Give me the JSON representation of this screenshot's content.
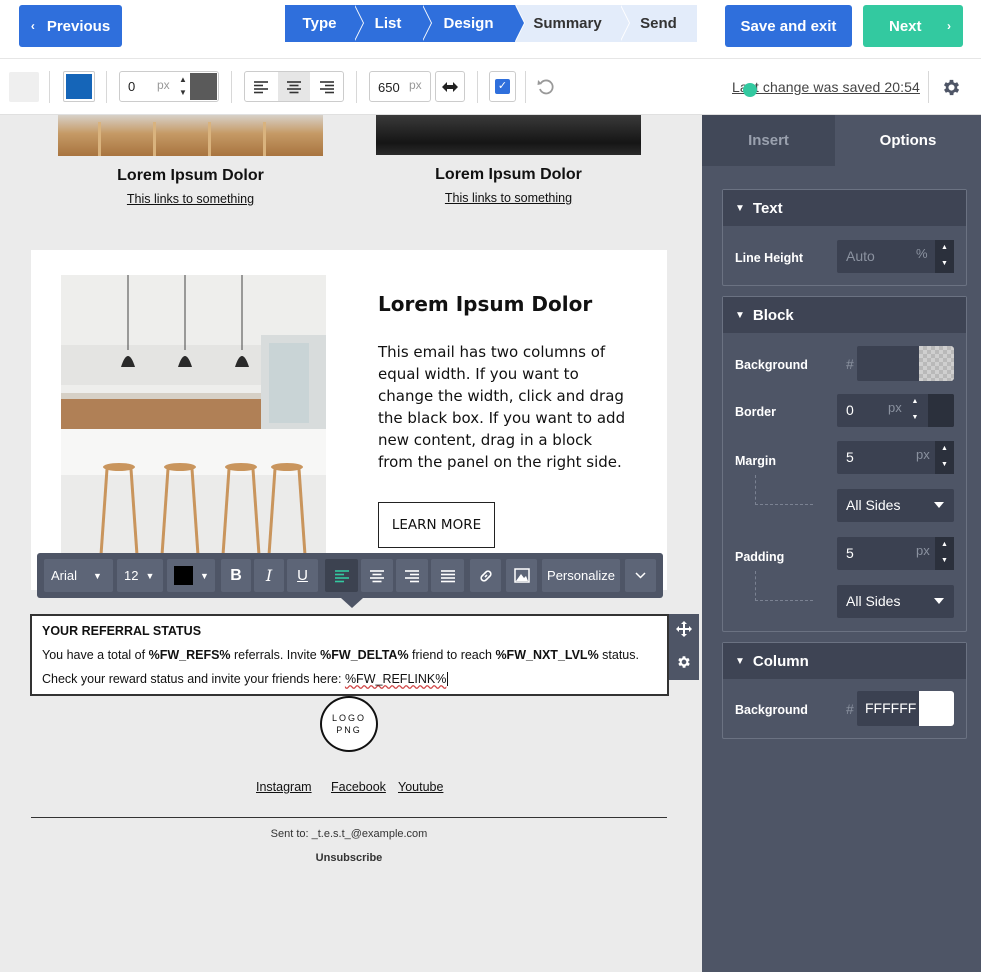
{
  "header": {
    "previous_label": "Previous",
    "save_exit_label": "Save and exit",
    "next_label": "Next",
    "steps": [
      {
        "label": "Type",
        "state": "done"
      },
      {
        "label": "List",
        "state": "done"
      },
      {
        "label": "Design",
        "state": "current"
      },
      {
        "label": "Summary",
        "state": "todo"
      },
      {
        "label": "Send",
        "state": "todo"
      }
    ]
  },
  "toolbar": {
    "border_value": "0",
    "border_unit": "px",
    "width_value": "650",
    "width_unit": "px",
    "saved_text": "Last change was saved 20:54",
    "icons": [
      "color-swatch-icon",
      "align-left-icon",
      "align-center-icon",
      "align-right-icon",
      "expand-width-icon",
      "checkbox-icon",
      "undo-icon",
      "gear-icon"
    ]
  },
  "canvas": {
    "products": [
      {
        "title": "Lorem Ipsum Dolor",
        "link": "This links to something"
      },
      {
        "title": "Lorem Ipsum Dolor",
        "link": "This links to something"
      }
    ],
    "content": {
      "title": "Lorem Ipsum Dolor",
      "body": "This email has two columns of equal width. If you want to change the width, click and drag the black box. If you want to add new content, drag in a block from the panel on the right side.",
      "button": "LEARN MORE"
    },
    "editor_bar": {
      "font": "Arial",
      "size": "12",
      "personalize": "Personalize"
    },
    "referral": {
      "title": "YOUR REFERRAL STATUS",
      "line1_a": "You have a total of ",
      "line1_b": "%FW_REFS%",
      "line1_c": " referrals. Invite ",
      "line1_d": "%FW_DELTA%",
      "line1_e": " friend to reach ",
      "line1_f": "%FW_NXT_LVL%",
      "line1_g": " status.",
      "line2_a": "Check your reward status and invite your friends here: ",
      "line2_b": "%FW_REFLINK%"
    },
    "logo": {
      "line1": "LOGO",
      "line2": "PNG"
    },
    "social": [
      "Instagram",
      "Facebook",
      "Youtube"
    ],
    "sent_to": "Sent to: _t.e.s.t_@example.com",
    "unsubscribe": "Unsubscribe"
  },
  "panel": {
    "tabs": [
      "Insert",
      "Options"
    ],
    "text_section": {
      "title": "Text",
      "line_height_label": "Line Height",
      "line_height_placeholder": "Auto",
      "line_height_unit": "%"
    },
    "block_section": {
      "title": "Block",
      "background_label": "Background",
      "border_label": "Border",
      "border_value": "0",
      "border_unit": "px",
      "margin_label": "Margin",
      "margin_value": "5",
      "margin_unit": "px",
      "margin_sides": "All Sides",
      "padding_label": "Padding",
      "padding_value": "5",
      "padding_unit": "px",
      "padding_sides": "All Sides"
    },
    "column_section": {
      "title": "Column",
      "background_label": "Background",
      "background_value": "FFFFFF",
      "background_color": "#FFFFFF"
    }
  },
  "colors": {
    "primary": "#2f6fdc",
    "accent": "#33c9a0",
    "panel": "#4e5566",
    "toolbar_blue_swatch": "#1565b8"
  }
}
